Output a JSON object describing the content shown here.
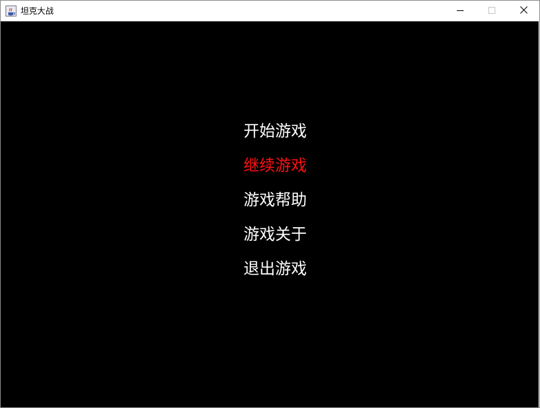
{
  "window": {
    "title": "坦克大战",
    "app_icon": "java-cup-icon",
    "controls": {
      "minimize_icon": "minimize-icon",
      "maximize_icon": "maximize-icon",
      "close_icon": "close-icon"
    }
  },
  "game": {
    "background_color": "#000000",
    "menu": {
      "items": [
        {
          "label": "开始游戏"
        },
        {
          "label": "继续游戏"
        },
        {
          "label": "游戏帮助"
        },
        {
          "label": "游戏关于"
        },
        {
          "label": "退出游戏"
        }
      ],
      "selected_index": 1,
      "normal_color": "#ffffff",
      "selected_color": "#ff1010"
    }
  }
}
